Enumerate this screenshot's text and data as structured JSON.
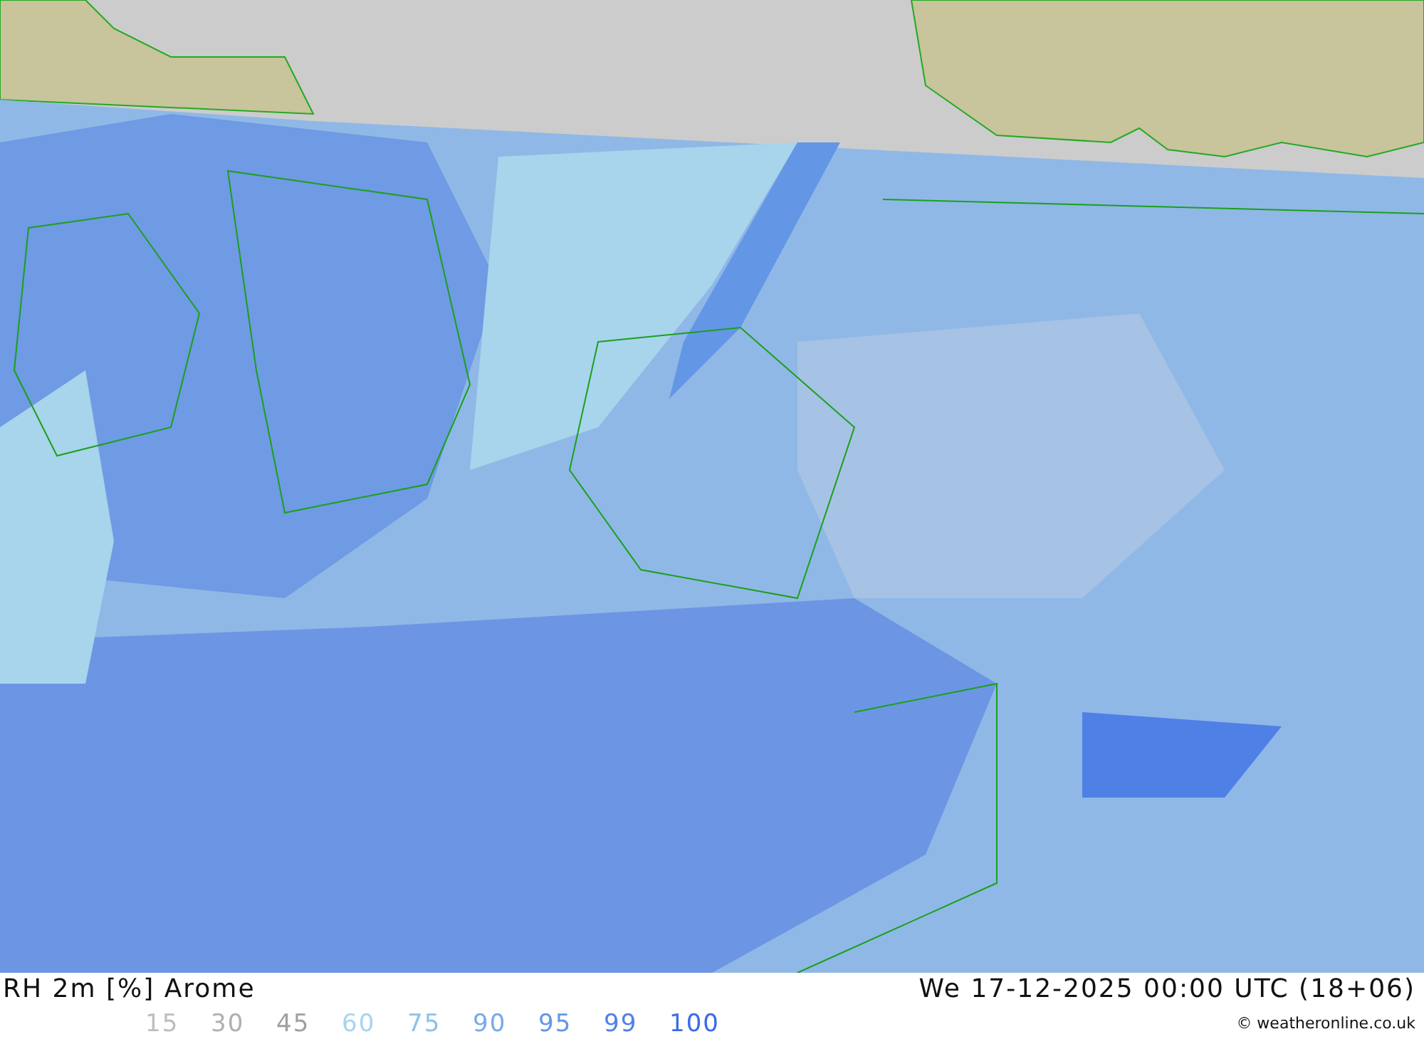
{
  "title": "RH 2m [%] Arome",
  "datetime": "We 17-12-2025 00:00 UTC (18+06)",
  "legend": [
    {
      "label": "15",
      "color": "#bdbdbd"
    },
    {
      "label": "30",
      "color": "#b0b0b0"
    },
    {
      "label": "45",
      "color": "#a0a0a0"
    },
    {
      "label": "60",
      "color": "#a8d4f0"
    },
    {
      "label": "75",
      "color": "#8cc2ea"
    },
    {
      "label": "90",
      "color": "#78aaec"
    },
    {
      "label": "95",
      "color": "#6496e8"
    },
    {
      "label": "99",
      "color": "#5080e8"
    },
    {
      "label": "100",
      "color": "#3c6aea"
    }
  ],
  "credit": "© weatheronline.co.uk"
}
